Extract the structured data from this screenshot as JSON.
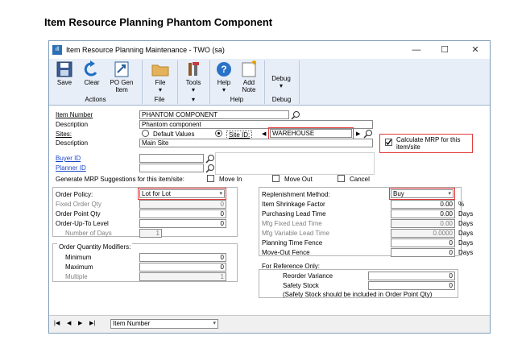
{
  "page_title": "Item Resource Planning Phantom Component",
  "window": {
    "title": "Item Resource Planning Maintenance  -  TWO (sa)",
    "controls": {
      "minimize": "—",
      "maximize": "☐",
      "close": "✕"
    }
  },
  "ribbon": {
    "buttons": {
      "save": "Save",
      "clear": "Clear",
      "po_gen_item": "PO Gen Item",
      "file": "File",
      "tools": "Tools",
      "help": "Help",
      "add_note": "Add Note",
      "debug": "Debug"
    },
    "groups": {
      "actions": "Actions",
      "file": "File",
      "help": "Help",
      "debug": "Debug"
    }
  },
  "form": {
    "item_number": {
      "label": "Item Number",
      "value": "PHANTOM COMPONENT"
    },
    "item_description": {
      "label": "Description",
      "value": "Phantom component"
    },
    "sites": {
      "label": "Sites:",
      "default_values": "Default Values",
      "site_id": "Site ID:",
      "value": "WAREHOUSE",
      "selected": "site_id"
    },
    "site_description": {
      "label": "Description",
      "value": "Main Site"
    },
    "calculate_mrp": {
      "label": "Calculate MRP for this item/site",
      "checked": true
    },
    "buyer_id": {
      "label": "Buyer ID",
      "value": ""
    },
    "planner_id": {
      "label": "Planner ID",
      "value": ""
    },
    "generate_mrp": {
      "label": "Generate MRP Suggestions for this item/site:",
      "move_in": "Move In",
      "move_out": "Move Out",
      "cancel": "Cancel"
    },
    "order_policy": {
      "label": "Order Policy:",
      "value": "Lot for Lot"
    },
    "fixed_order_qty": {
      "label": "Fixed Order Qty",
      "value": "0"
    },
    "order_point_qty": {
      "label": "Order Point Qty",
      "value": "0"
    },
    "order_up_to_level": {
      "label": "Order-Up-To Level",
      "value": "0"
    },
    "number_of_days": {
      "label": "Number of Days",
      "value": "1"
    },
    "order_qty_modifiers": {
      "label": "Order Quantity Modifiers:",
      "minimum": {
        "label": "Minimum",
        "value": "0"
      },
      "maximum": {
        "label": "Maximum",
        "value": "0"
      },
      "multiple": {
        "label": "Multiple",
        "value": "1"
      }
    },
    "replenishment_method": {
      "label": "Replenishment Method:",
      "value": "Buy"
    },
    "item_shrinkage_factor": {
      "label": "Item Shrinkage Factor",
      "value": "0.00",
      "unit": "%"
    },
    "purchasing_lead_time": {
      "label": "Purchasing Lead Time",
      "value": "0.00",
      "unit": "Days"
    },
    "mfg_fixed_lead_time": {
      "label": "Mfg Fixed Lead Time",
      "value": "0.00",
      "unit": "Days"
    },
    "mfg_variable_lead_time": {
      "label": "Mfg Variable Lead Time",
      "value": "0.0000",
      "unit": "Days"
    },
    "planning_time_fence": {
      "label": "Planning Time Fence",
      "value": "0",
      "unit": "Days"
    },
    "move_out_fence": {
      "label": "Move-Out Fence",
      "value": "0",
      "unit": "Days"
    },
    "for_reference": {
      "label": "For Reference Only:",
      "reorder_variance": {
        "label": "Reorder Variance",
        "value": "0"
      },
      "safety_stock": {
        "label": "Safety Stock",
        "value": "0"
      },
      "note": "(Safety Stock should be included in Order Point Qty)"
    }
  },
  "statusbar": {
    "nav": {
      "first": "|◀",
      "prev": "◀",
      "next": "▶",
      "last": "▶|"
    },
    "sort_by": "Item Number"
  },
  "colors": {
    "highlight_border": "#e23b3b",
    "link": "#1a46c8",
    "ribbon_bg": "#e8eef8"
  }
}
